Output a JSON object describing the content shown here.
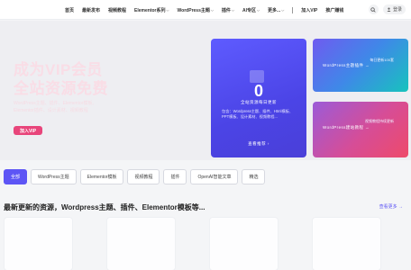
{
  "header": {
    "nav": [
      {
        "label": "首页",
        "dropdown": false
      },
      {
        "label": "最新发布",
        "dropdown": false
      },
      {
        "label": "视频教程",
        "dropdown": false
      },
      {
        "label": "Elementor系列",
        "dropdown": true
      },
      {
        "label": "WordPress主题",
        "dropdown": true
      },
      {
        "label": "插件",
        "dropdown": true
      },
      {
        "label": "AI专区",
        "dropdown": true
      },
      {
        "label": "更多...",
        "dropdown": true
      }
    ],
    "nav_extra": [
      {
        "label": "加入VIP"
      },
      {
        "label": "推广赚钱"
      }
    ],
    "login_label": "登录",
    "icons": {
      "search": "search-icon",
      "user": "user-icon"
    }
  },
  "hero": {
    "title_line1": "成为VIP会员",
    "title_line2": "全站资源免费",
    "description": "WordPress主题、插件、Elementor模板、Elementor插件、设计素材、视频教程",
    "button_label": "加入VIP"
  },
  "cards": {
    "main": {
      "count": "0",
      "title": "全站资源每日更新",
      "desc": "包含：Wordpress主题、插件、Html模板、PPT模板、设计素材、视频教程...",
      "more": "查看推荐"
    },
    "top": {
      "sub": "每日更新100套",
      "main": "WordPress主题插件 →"
    },
    "bottom": {
      "sub": "视频教程持续更新",
      "main": "WordPress建站教程 →"
    }
  },
  "filters": [
    {
      "label": "全部",
      "active": true
    },
    {
      "label": "WordPress主题",
      "active": false
    },
    {
      "label": "Elementor模板",
      "active": false
    },
    {
      "label": "视频教程",
      "active": false
    },
    {
      "label": "插件",
      "active": false
    },
    {
      "label": "OpenAI智能文章",
      "active": false
    },
    {
      "label": "精选",
      "active": false
    }
  ],
  "section": {
    "title": "最新更新的资源，Wordpress主题、插件、Elementor模板等...",
    "more_label": "查看更多 →"
  },
  "colors": {
    "accent": "#5d55f5",
    "vip_button": "#e8457b",
    "card_main": "#4f48eb"
  }
}
